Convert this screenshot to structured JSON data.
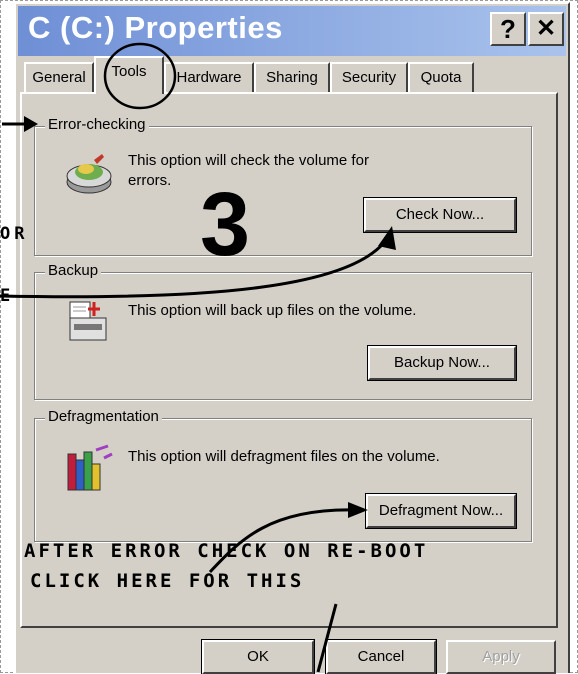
{
  "window": {
    "title": "C (C:) Properties",
    "help_label": "?",
    "close_label": "✕"
  },
  "tabs": [
    {
      "label": "General"
    },
    {
      "label": "Tools"
    },
    {
      "label": "Hardware"
    },
    {
      "label": "Sharing"
    },
    {
      "label": "Security"
    },
    {
      "label": "Quota"
    }
  ],
  "active_tab": "Tools",
  "error_checking": {
    "label": "Error-checking",
    "description_line1": "This option will check the volume for",
    "description_line2": "errors.",
    "button": "Check Now..."
  },
  "backup": {
    "label": "Backup",
    "description": "This option will back up files on the volume.",
    "button": "Backup Now..."
  },
  "defrag": {
    "label": "Defragmentation",
    "description": "This option will defragment files on the volume.",
    "button": "Defragment Now..."
  },
  "annotations": {
    "step_number": "3",
    "line1": "AFTER ERROR CHECK ON RE-BOOT",
    "line2": "CLICK HERE FOR THIS",
    "left_fragment1": "OR",
    "left_fragment2": "E"
  },
  "footer": {
    "ok": "OK",
    "cancel": "Cancel",
    "apply": "Apply"
  },
  "colors": {
    "dialog_bg": "#d4d0c8",
    "title_gradient_start": "#6f8fd6",
    "title_gradient_end": "#a9c3ec"
  }
}
